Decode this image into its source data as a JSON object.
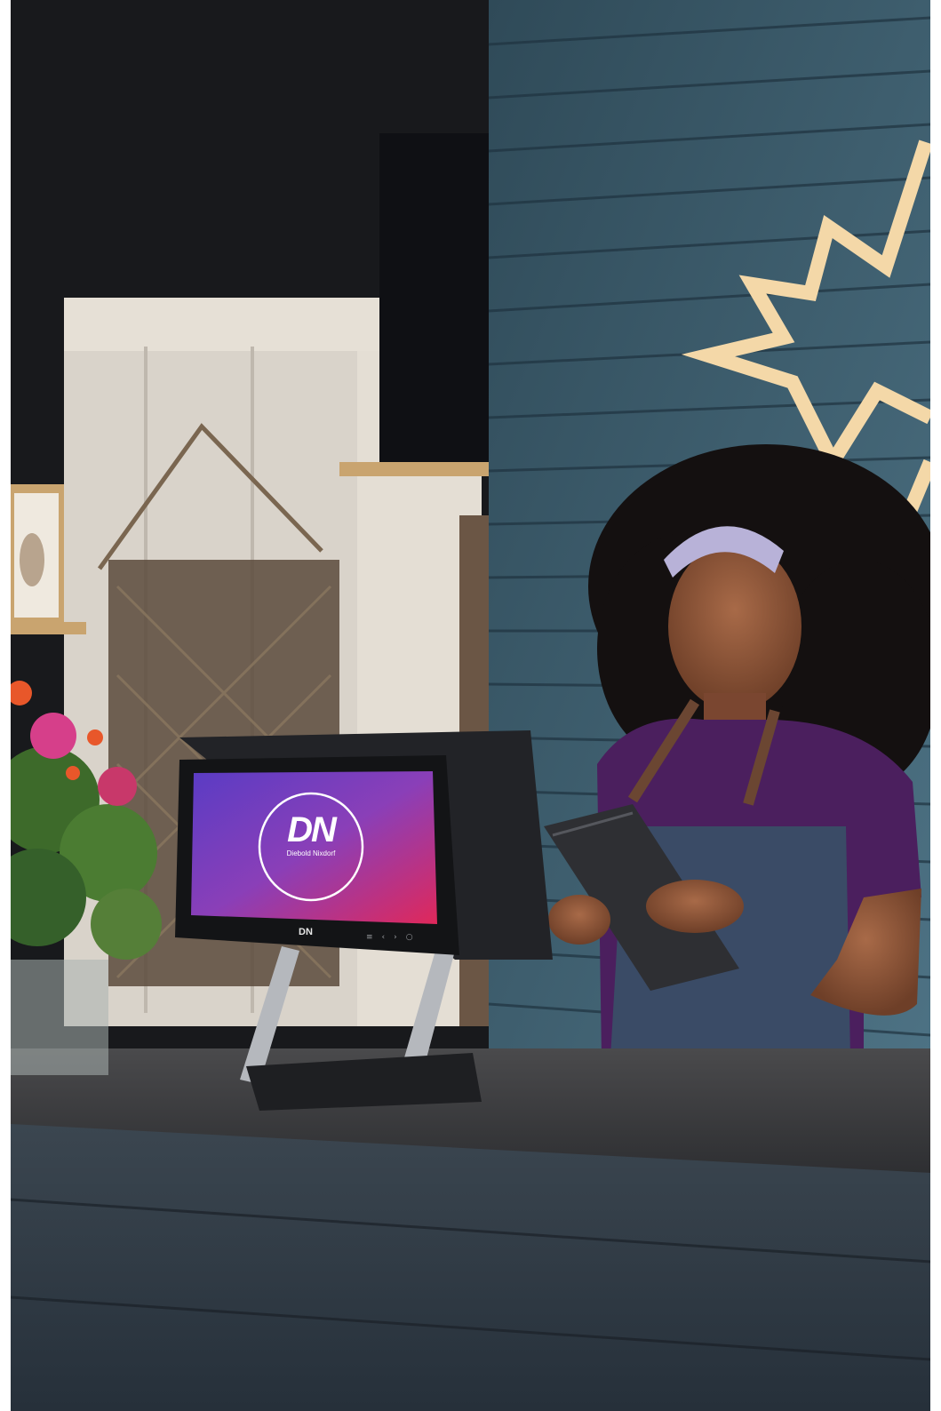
{
  "scene": {
    "description_free": true
  },
  "screen": {
    "logo_mark": "DN",
    "brand_name": "Diebold Nixdorf",
    "bezel_mark": "DN"
  },
  "colors": {
    "wall_blue": "#3e5f70",
    "wall_dark": "#18191c",
    "counter": "#3a3a3c",
    "screen_purple": "#6a3fc0",
    "screen_pink": "#e0305a",
    "shirt": "#4b1f5e",
    "apron": "#3a4b66",
    "neon_star": "#f4d8a8"
  },
  "icons": {
    "logo": "diebold-nixdorf-logo",
    "bezel_buttons": [
      "menu-icon",
      "chevron-left-icon",
      "chevron-right-icon",
      "power-icon"
    ]
  }
}
